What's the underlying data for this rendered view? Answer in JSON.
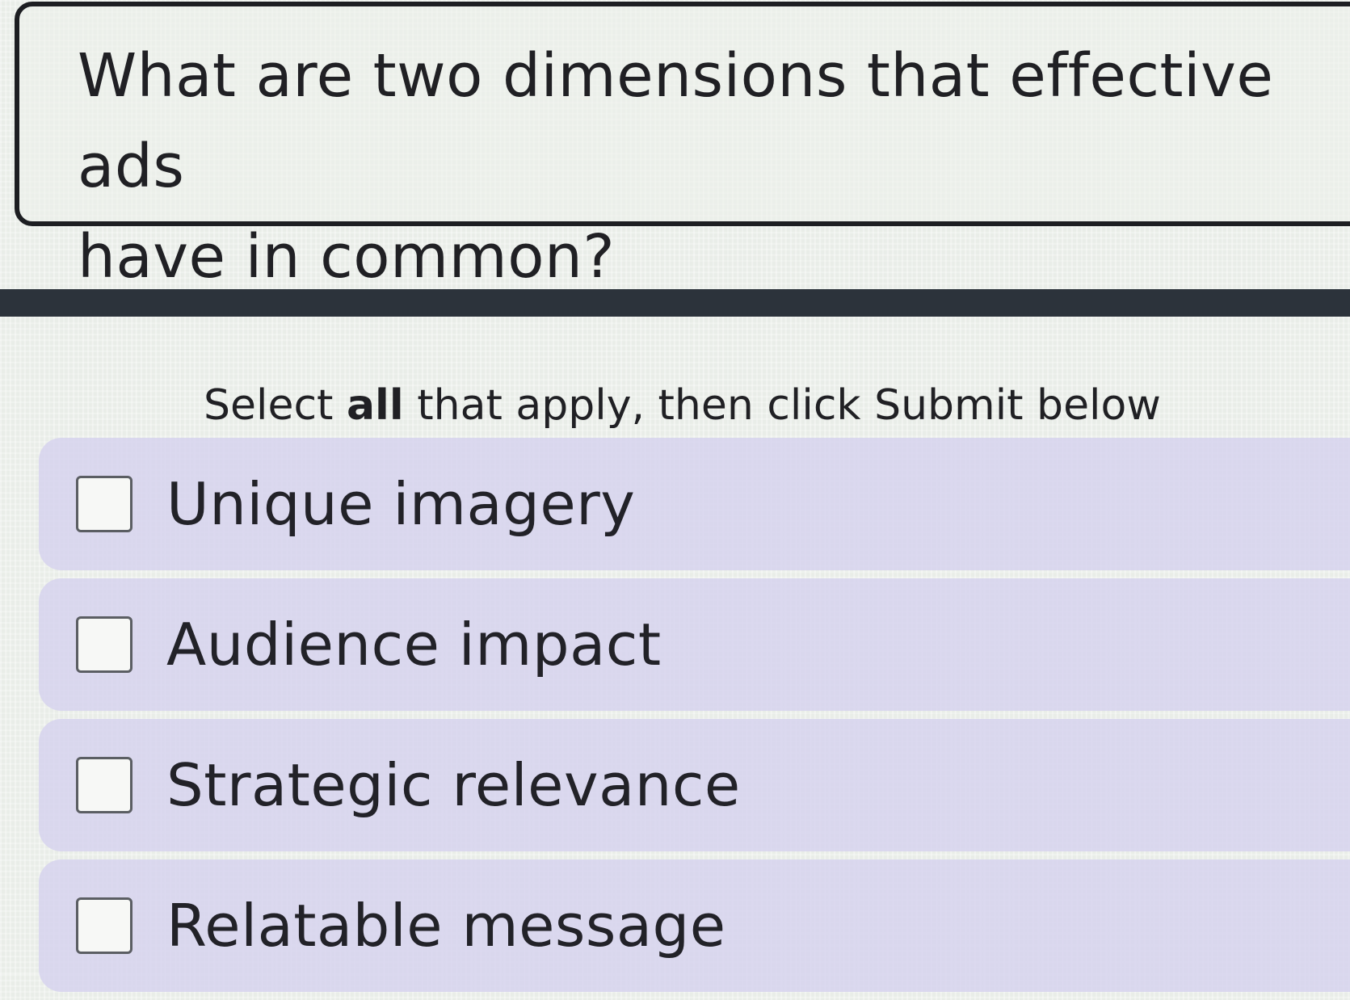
{
  "question": {
    "line1": "What are two dimensions that effective ads",
    "line2": "have in common?"
  },
  "instruction": {
    "prefix": "Select ",
    "emphasis": "all",
    "suffix": " that apply, then click Submit below"
  },
  "options": [
    {
      "label": "Unique imagery",
      "checked": false
    },
    {
      "label": "Audience impact",
      "checked": false
    },
    {
      "label": "Strategic relevance",
      "checked": false
    },
    {
      "label": "Relatable message",
      "checked": false
    }
  ],
  "colors": {
    "option_background": "#d6d2ee",
    "divider": "#2c333b",
    "card_border": "#1d1e22"
  }
}
